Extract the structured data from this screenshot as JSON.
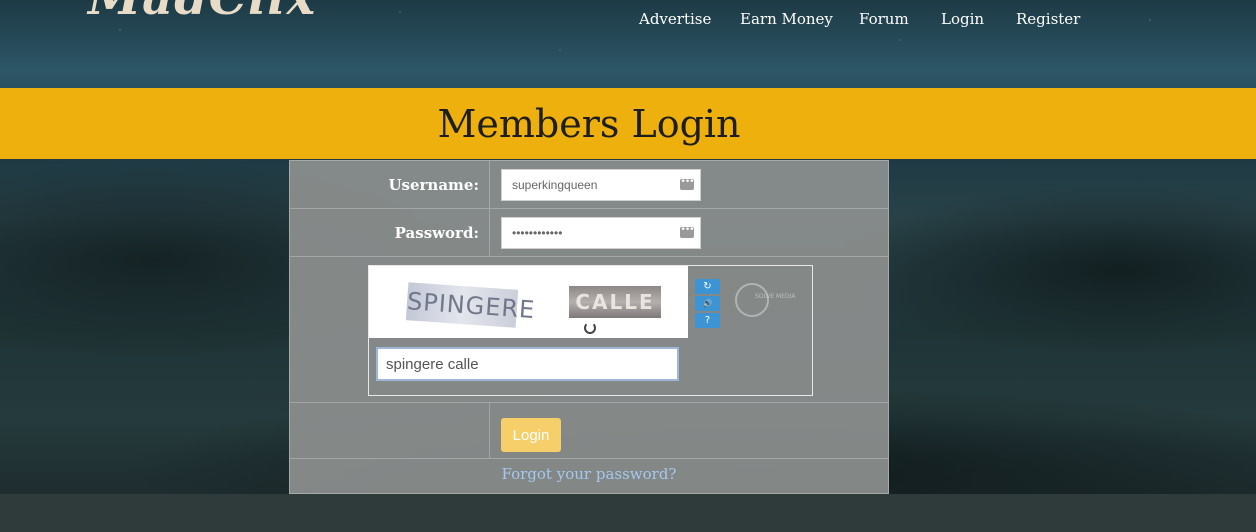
{
  "brand": {
    "logo_text": "MadClix"
  },
  "nav": {
    "items": [
      {
        "label": "Advertise"
      },
      {
        "label": "Earn Money"
      },
      {
        "label": "Forum"
      },
      {
        "label": "Login"
      },
      {
        "label": "Register"
      }
    ]
  },
  "banner": {
    "title": "Members Login"
  },
  "form": {
    "username_label": "Username:",
    "username_value": "superkingqueen",
    "password_label": "Password:",
    "password_value": "••••••••••••",
    "captcha": {
      "word1": "SPINGERE",
      "word2": "CALLE",
      "input_value": "spingere calle",
      "buttons": [
        {
          "icon": "refresh-icon",
          "glyph": "↻"
        },
        {
          "icon": "audio-icon",
          "glyph": "🔊"
        },
        {
          "icon": "help-icon",
          "glyph": "?"
        }
      ],
      "logo_text": "SOLVE MEDIA"
    },
    "login_button": "Login",
    "forgot_link": "Forgot your password?"
  },
  "colors": {
    "banner": "#eeb00c",
    "panel": "#8c8f8e",
    "login_button": "#f7cf6a",
    "link": "#a6c8ee",
    "captcha_button": "#3c94d4"
  }
}
